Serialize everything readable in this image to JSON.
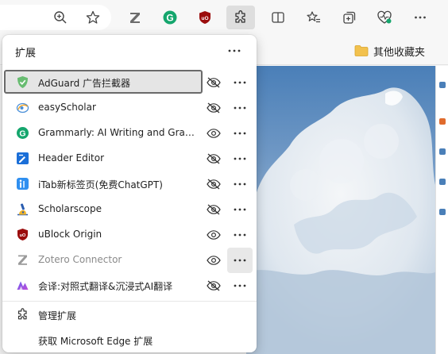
{
  "toolbar": {
    "icons": [
      "zoom-icon",
      "favorite-star-icon",
      "zotero-icon",
      "grammarly-icon",
      "ublock-icon",
      "extensions-icon",
      "split-screen-icon",
      "favorites-list-icon",
      "collections-icon",
      "browser-essentials-icon",
      "settings-more-icon"
    ]
  },
  "favorites_bar": {
    "other_favorites_label": "其他收藏夹"
  },
  "popup": {
    "title": "扩展",
    "extensions": [
      {
        "name": "AdGuard 广告拦截器",
        "icon": "adguard-icon",
        "pinned": false,
        "selected": true,
        "disabled": false
      },
      {
        "name": "easyScholar",
        "icon": "easyscholar-icon",
        "pinned": false,
        "selected": false,
        "disabled": false
      },
      {
        "name": "Grammarly: AI Writing and Grammar Checker",
        "icon": "grammarly-icon",
        "pinned": true,
        "selected": false,
        "disabled": false
      },
      {
        "name": "Header Editor",
        "icon": "header-editor-icon",
        "pinned": false,
        "selected": false,
        "disabled": false
      },
      {
        "name": "iTab新标签页(免费ChatGPT)",
        "icon": "itab-icon",
        "pinned": false,
        "selected": false,
        "disabled": false
      },
      {
        "name": "Scholarscope",
        "icon": "scholarscope-icon",
        "pinned": false,
        "selected": false,
        "disabled": false
      },
      {
        "name": "uBlock Origin",
        "icon": "ublock-icon",
        "pinned": true,
        "selected": false,
        "disabled": false
      },
      {
        "name": "Zotero Connector",
        "icon": "zotero-icon",
        "pinned": true,
        "selected": false,
        "disabled": true
      },
      {
        "name": "会译:对照式翻译&沉浸式AI翻译",
        "icon": "huiyi-translate-icon",
        "pinned": false,
        "selected": false,
        "disabled": false
      }
    ],
    "manage_label": "管理扩展",
    "get_label": "获取 Microsoft Edge 扩展"
  }
}
